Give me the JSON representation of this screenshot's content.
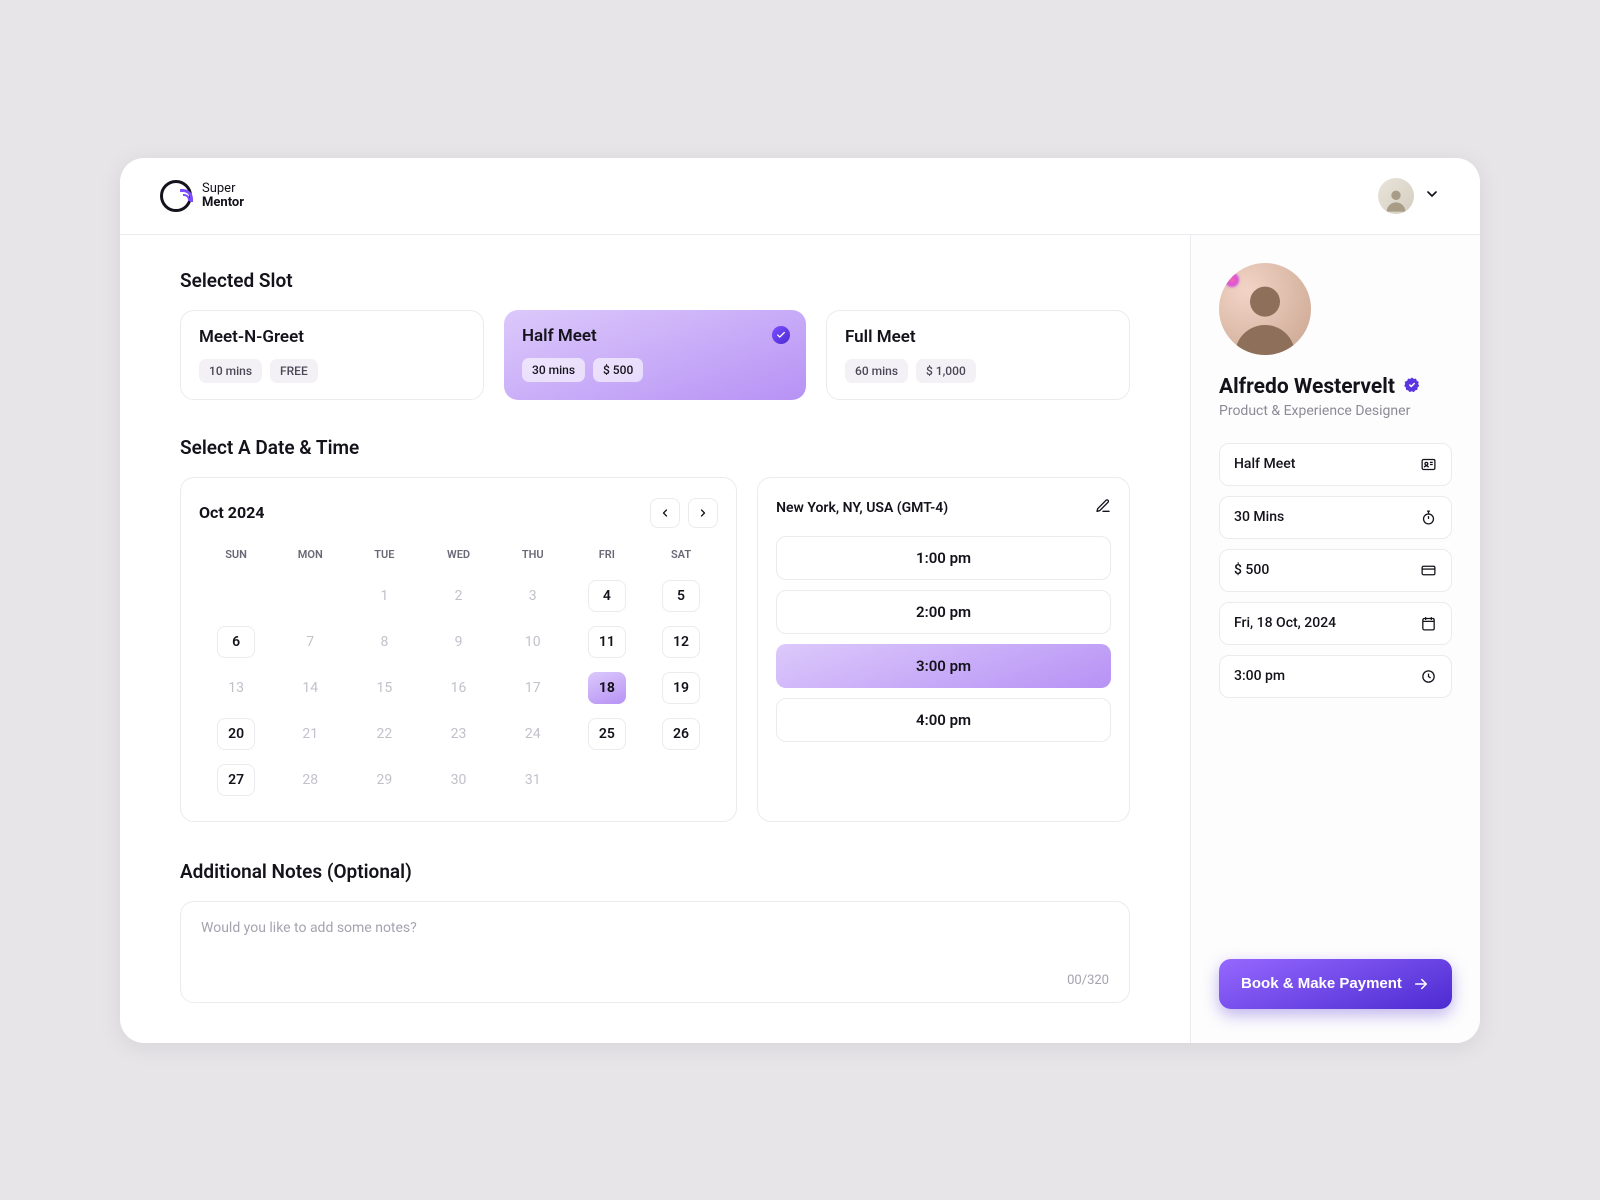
{
  "brand": {
    "line1": "Super",
    "line2": "Mentor"
  },
  "section_titles": {
    "selected_slot": "Selected Slot",
    "select_dt": "Select A Date & Time",
    "notes": "Additional Notes (Optional)"
  },
  "slots": [
    {
      "name": "Meet-N-Greet",
      "duration": "10 mins",
      "price": "FREE",
      "selected": false
    },
    {
      "name": "Half Meet",
      "duration": "30 mins",
      "price": "$ 500",
      "selected": true
    },
    {
      "name": "Full Meet",
      "duration": "60 mins",
      "price": "$ 1,000",
      "selected": false
    }
  ],
  "calendar": {
    "title": "Oct 2024",
    "dow": [
      "SUN",
      "MON",
      "TUE",
      "WED",
      "THU",
      "FRI",
      "SAT"
    ],
    "weeks": [
      [
        null,
        null,
        {
          "n": "1",
          "state": "dim"
        },
        {
          "n": "2",
          "state": "dim"
        },
        {
          "n": "3",
          "state": "dim"
        },
        {
          "n": "4",
          "state": "available"
        },
        {
          "n": "5",
          "state": "available"
        }
      ],
      [
        {
          "n": "6",
          "state": "available"
        },
        {
          "n": "7",
          "state": "dim"
        },
        {
          "n": "8",
          "state": "dim"
        },
        {
          "n": "9",
          "state": "dim"
        },
        {
          "n": "10",
          "state": "dim"
        },
        {
          "n": "11",
          "state": "available"
        },
        {
          "n": "12",
          "state": "available"
        }
      ],
      [
        {
          "n": "13",
          "state": "dim"
        },
        {
          "n": "14",
          "state": "dim"
        },
        {
          "n": "15",
          "state": "dim"
        },
        {
          "n": "16",
          "state": "dim"
        },
        {
          "n": "17",
          "state": "dim"
        },
        {
          "n": "18",
          "state": "selected"
        },
        {
          "n": "19",
          "state": "available"
        }
      ],
      [
        {
          "n": "20",
          "state": "available"
        },
        {
          "n": "21",
          "state": "dim"
        },
        {
          "n": "22",
          "state": "dim"
        },
        {
          "n": "23",
          "state": "dim"
        },
        {
          "n": "24",
          "state": "dim"
        },
        {
          "n": "25",
          "state": "available"
        },
        {
          "n": "26",
          "state": "available"
        }
      ],
      [
        {
          "n": "27",
          "state": "available"
        },
        {
          "n": "28",
          "state": "dim"
        },
        {
          "n": "29",
          "state": "dim"
        },
        {
          "n": "30",
          "state": "dim"
        },
        {
          "n": "31",
          "state": "dim"
        },
        null,
        null
      ]
    ]
  },
  "timezone": "New York, NY, USA (GMT-4)",
  "times": [
    {
      "label": "1:00 pm",
      "selected": false
    },
    {
      "label": "2:00 pm",
      "selected": false
    },
    {
      "label": "3:00 pm",
      "selected": true
    },
    {
      "label": "4:00 pm",
      "selected": false
    }
  ],
  "notes": {
    "placeholder": "Would you like to add some notes?",
    "counter": "00/320"
  },
  "mentor": {
    "name": "Alfredo Westervelt",
    "role": "Product & Experience Designer"
  },
  "summary": {
    "slot": "Half Meet",
    "duration": "30 Mins",
    "price": "$ 500",
    "date": "Fri, 18 Oct, 2024",
    "time": "3:00 pm"
  },
  "cta_label": "Book & Make Payment"
}
